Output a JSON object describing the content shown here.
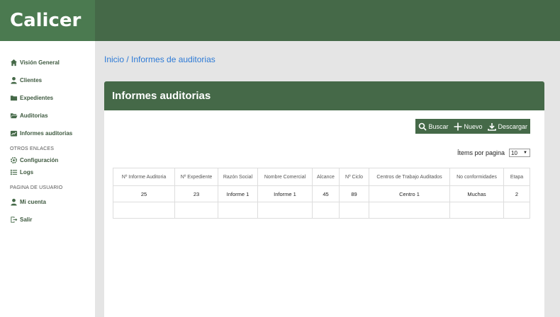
{
  "app": {
    "title": "Calicer"
  },
  "sidebar": {
    "items": [
      {
        "label": "Visión General",
        "icon": "home-icon"
      },
      {
        "label": "Clientes",
        "icon": "user-icon"
      },
      {
        "label": "Expedientes",
        "icon": "folder-icon"
      },
      {
        "label": "Auditorias",
        "icon": "folder-open-icon"
      },
      {
        "label": "Informes auditorias",
        "icon": "chart-icon"
      }
    ],
    "section_otros": "OTROS ENLACES",
    "otros": [
      {
        "label": "Configuración",
        "icon": "gear-icon"
      },
      {
        "label": "Logs",
        "icon": "list-icon"
      }
    ],
    "section_usuario": "PAGINA DE USUARIO",
    "usuario": [
      {
        "label": "Mi cuenta",
        "icon": "user-icon"
      },
      {
        "label": "Salir",
        "icon": "logout-icon"
      }
    ]
  },
  "breadcrumb": "Inicio / Informes de auditorias",
  "card": {
    "title": "Informes auditorias"
  },
  "toolbar": {
    "search": "Buscar",
    "new": "Nuevo",
    "download": "Descargar"
  },
  "pagination": {
    "label": "Ítems por pagina",
    "value": "10"
  },
  "table": {
    "headers": [
      "Nº Informe Auditoria",
      "Nº Expediente",
      "Razón Social",
      "Nombre Comercial",
      "Alcance",
      "Nº Ciclo",
      "Centros de Trabajo Auditados",
      "No conformidades",
      "Etapa"
    ],
    "rows": [
      [
        "25",
        "23",
        "Informe 1",
        "Informe 1",
        "45",
        "89",
        "Centro 1",
        "Muchas",
        "2"
      ],
      [
        "",
        "",
        "",
        "",
        "",
        "",
        "",
        "",
        ""
      ]
    ]
  },
  "colors": {
    "primary": "#456948",
    "logo_bg": "#4b7a50",
    "link": "#2d7ad6"
  }
}
